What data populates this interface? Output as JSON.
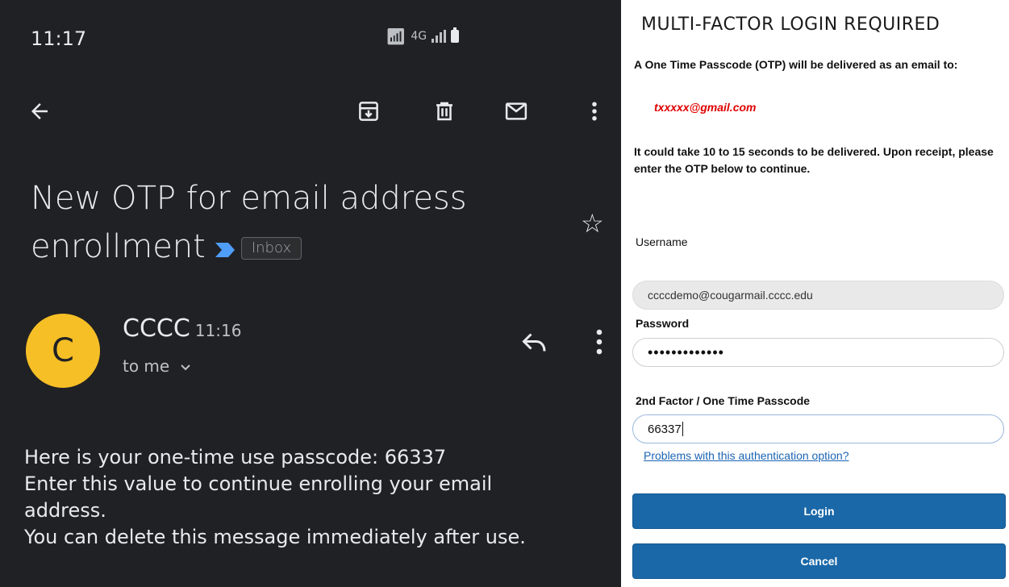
{
  "phone": {
    "status": {
      "time": "11:17",
      "network": "4G"
    },
    "icons": {
      "back": "arrow-left-icon",
      "archive": "archive-icon",
      "delete": "trash-icon",
      "mark_unread": "mail-icon",
      "more": "more-vert-icon",
      "star": "star-outline-icon",
      "reply": "reply-icon",
      "important": "important-marker-icon"
    },
    "email": {
      "subject": "New OTP for email address enrollment",
      "label": "Inbox",
      "avatar_letter": "C",
      "sender": "CCCC",
      "time": "11:16",
      "recipient": "to me",
      "body": [
        "Here is your one-time use passcode: 66337",
        "Enter this value to continue enrolling your email",
        "address.",
        "You can delete this message immediately after use."
      ]
    },
    "colors": {
      "background": "#202124",
      "avatar": "#f6bf26",
      "important": "#4f9ef8"
    }
  },
  "login": {
    "title": "MULTI-FACTOR LOGIN REQUIRED",
    "info": "A One Time Passcode (OTP) will be delivered as an email to:",
    "email": "txxxxx@gmail.com",
    "info2": "It could take 10 to 15 seconds to be delivered. Upon receipt, please enter the OTP below to continue.",
    "username_label": "Username",
    "username_value": "ccccdemo@cougarmail.cccc.edu",
    "password_label": "Password",
    "password_value": "•••••••••••••",
    "otp_label": "2nd Factor / One Time Passcode",
    "otp_value": "66337",
    "problems_link": "Problems with this authentication option?",
    "login_button": "Login",
    "cancel_button": "Cancel",
    "colors": {
      "button": "#1a68a8",
      "email": "#e00000",
      "link": "#1a64b4"
    }
  }
}
